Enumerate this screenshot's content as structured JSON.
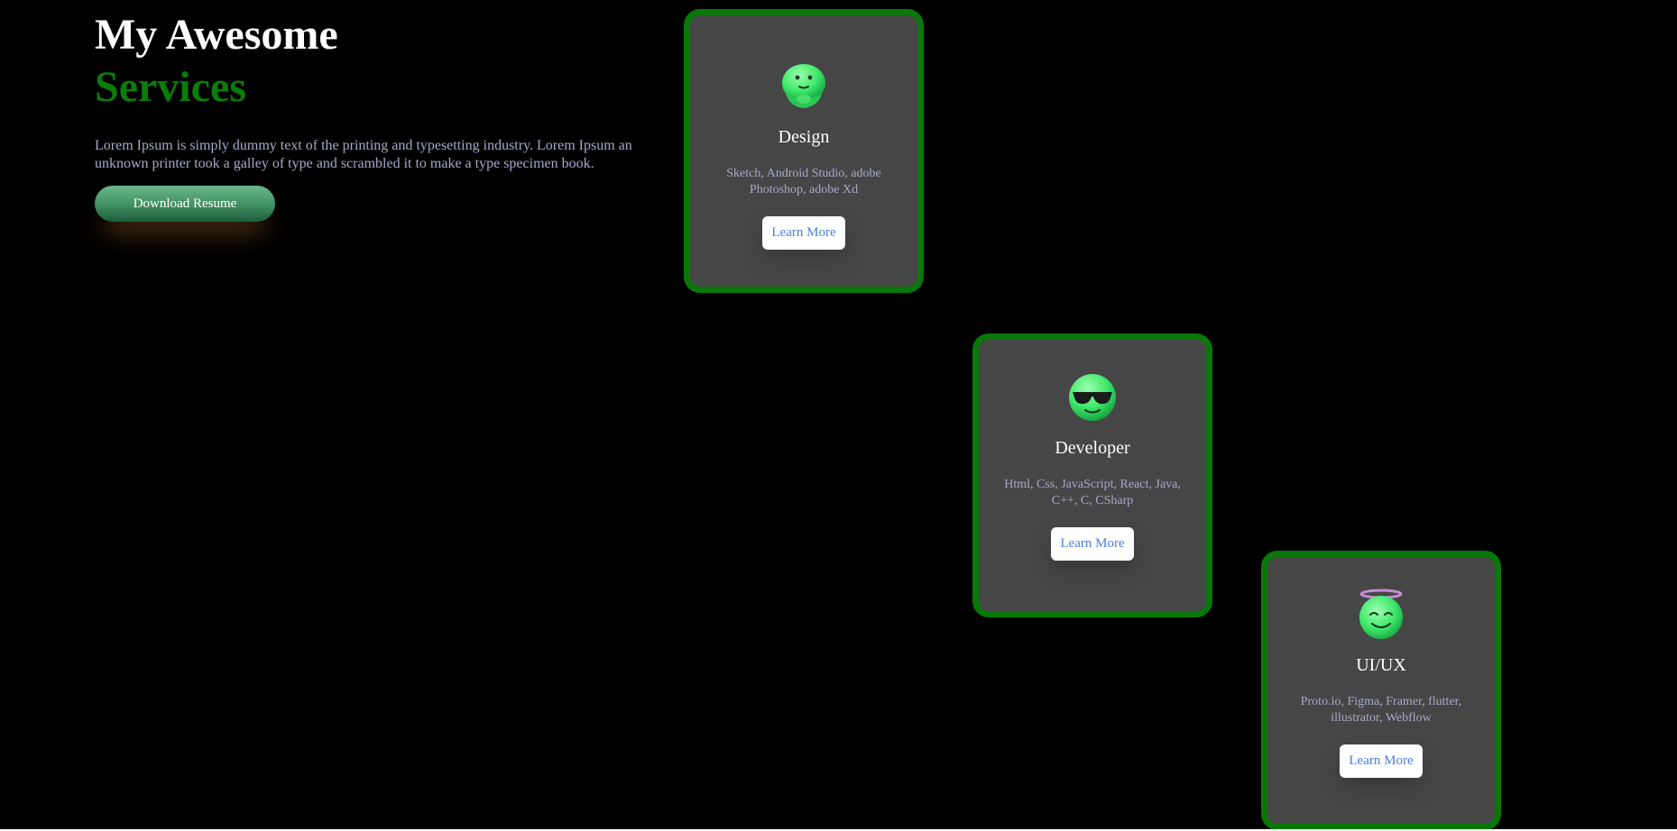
{
  "hero": {
    "title_line1": "My Awesome",
    "title_line2": "Services",
    "description": "Lorem Ipsum is simply dummy text of the printing and typesetting industry. Lorem Ipsum an unknown printer took a galley of type and scrambled it to make a type specimen book.",
    "button_label": "Download Resume"
  },
  "cards": [
    {
      "icon": "hugging-face-emoji-icon",
      "title": "Design",
      "description": "Sketch, Android Studio, adobe Photoshop, adobe Xd",
      "button_label": "Learn More"
    },
    {
      "icon": "sunglasses-face-emoji-icon",
      "title": "Developer",
      "description": "Html, Css, JavaScript, React, Java, C++, C, CSharp",
      "button_label": "Learn More"
    },
    {
      "icon": "halo-face-emoji-icon",
      "title": "UI/UX",
      "description": "Proto.io, Figma, Framer, flutter, illustrator, Webflow",
      "button_label": "Learn More"
    }
  ],
  "colors": {
    "background": "#000000",
    "accent_green": "#0a7d0a",
    "card_background": "#464646",
    "card_border": "#097709",
    "muted_text": "#a6a9c9",
    "link_blue": "#4b7fe0"
  }
}
